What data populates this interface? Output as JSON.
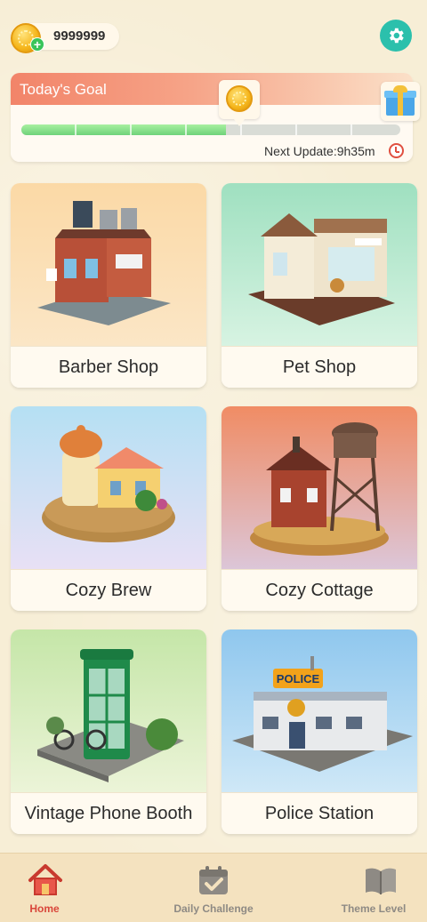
{
  "header": {
    "coins": "9999999",
    "coin_icon": "gold-coin-icon",
    "settings_icon": "gear-icon"
  },
  "goal": {
    "title": "Today's Goal",
    "progress": 0.54,
    "next_update_label": "Next Update:9h35m",
    "milestone_icon": "gold-coin-icon",
    "reward_icon": "gift-box-icon"
  },
  "themes": [
    {
      "label": "Barber Shop"
    },
    {
      "label": "Pet Shop"
    },
    {
      "label": "Cozy Brew"
    },
    {
      "label": "Cozy Cottage"
    },
    {
      "label": "Vintage Phone Booth"
    },
    {
      "label": "Police Station"
    }
  ],
  "nav": {
    "home": "Home",
    "daily": "Daily Challenge",
    "theme": "Theme Level"
  },
  "colors": {
    "accent": "#2bc0ac",
    "active_nav": "#d9463a",
    "progress": "#6fd27a"
  }
}
